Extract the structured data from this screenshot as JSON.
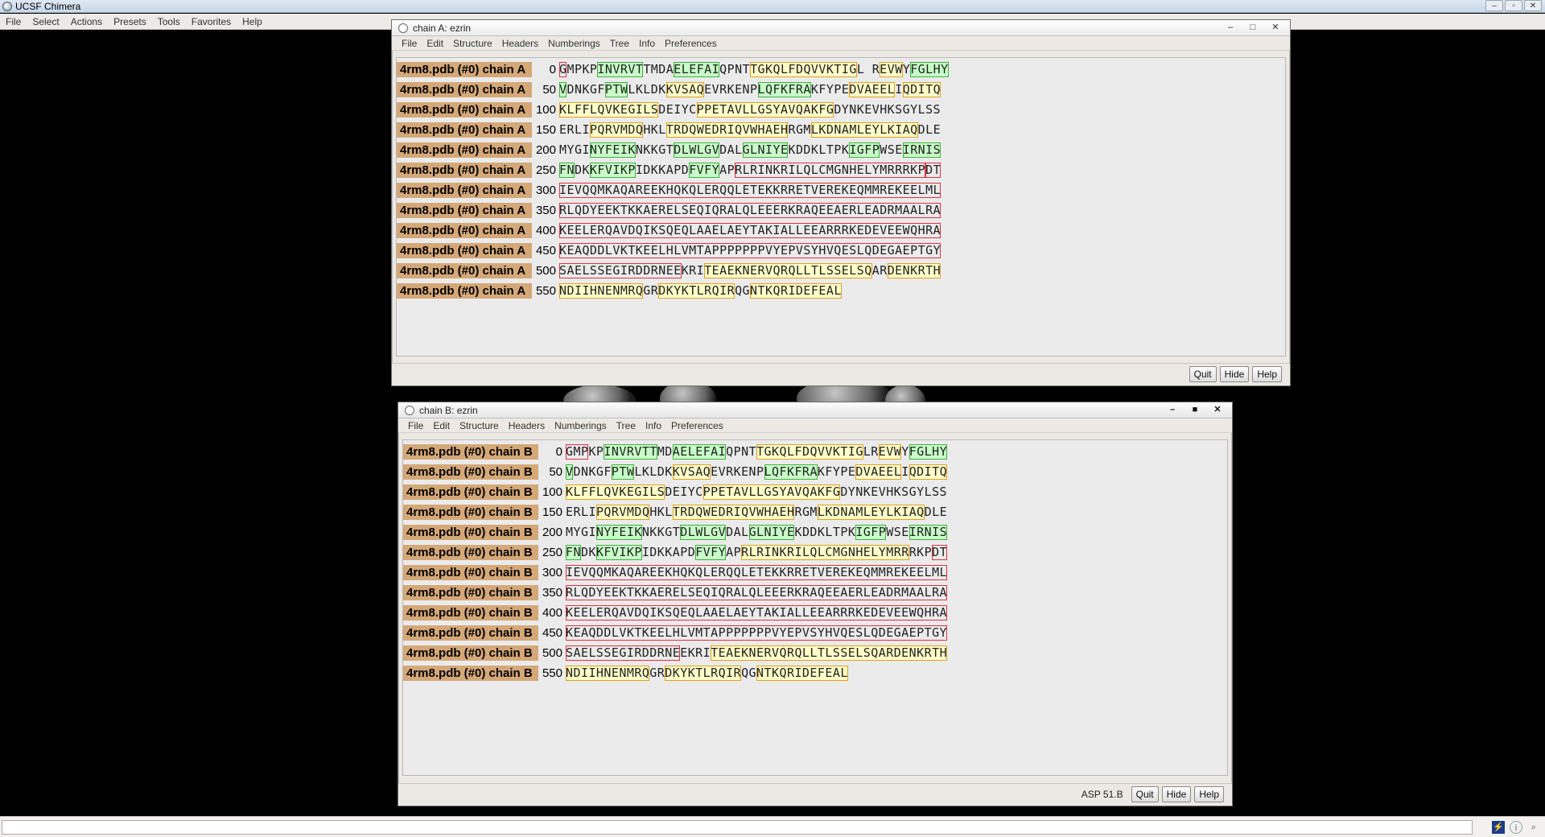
{
  "app": {
    "title": "UCSF Chimera",
    "menu": [
      "File",
      "Select",
      "Actions",
      "Presets",
      "Tools",
      "Favorites",
      "Help"
    ],
    "window_controls": [
      "–",
      "▫",
      "✕"
    ]
  },
  "windows": [
    {
      "title": "chain A: ezrin",
      "menu": [
        "File",
        "Edit",
        "Structure",
        "Headers",
        "Numberings",
        "Tree",
        "Info",
        "Preferences"
      ],
      "controls": [
        "–",
        "□",
        "✕"
      ],
      "status_text": "",
      "buttons": [
        "Quit",
        "Hide",
        "Help"
      ],
      "rows": [
        {
          "name": "4rm8.pdb (#0) chain A",
          "num": "0",
          "segs": [
            [
              "n",
              "0"
            ],
            [
              "r",
              "G"
            ],
            [
              "n",
              "MPKP"
            ],
            [
              "s",
              "INVRVT"
            ],
            [
              "n",
              "TMDA"
            ],
            [
              "s",
              "ELEFAI"
            ],
            [
              "n",
              "QPNT"
            ],
            [
              "h",
              "TGKQLFDQVVKTIG"
            ],
            [
              "n",
              "L R"
            ],
            [
              "h",
              "EVW"
            ],
            [
              "n",
              "Y"
            ],
            [
              "s",
              "FGLHY"
            ]
          ]
        },
        {
          "name": "4rm8.pdb (#0) chain A",
          "num": "50",
          "segs": [
            [
              "s",
              "V"
            ],
            [
              "n",
              "DNKGF"
            ],
            [
              "s",
              "PTW"
            ],
            [
              "n",
              "LKLDK"
            ],
            [
              "h",
              "KVSAQ"
            ],
            [
              "n",
              "EVRKENP"
            ],
            [
              "s",
              "LQFKFRA"
            ],
            [
              "n",
              "KFYPE"
            ],
            [
              "h",
              "DVAEEL"
            ],
            [
              "n",
              "I"
            ],
            [
              "h",
              "QDITQ"
            ]
          ]
        },
        {
          "name": "4rm8.pdb (#0) chain A",
          "num": "100",
          "segs": [
            [
              "h",
              "KLFFLQVKEGILS"
            ],
            [
              "n",
              "DEIYC"
            ],
            [
              "h",
              "PPETAVLLGSYAVQAKFG"
            ],
            [
              "n",
              "DYNKEVHKSGYLSS"
            ]
          ]
        },
        {
          "name": "4rm8.pdb (#0) chain A",
          "num": "150",
          "segs": [
            [
              "n",
              "ERLI"
            ],
            [
              "h",
              "PQRVMDQ"
            ],
            [
              "n",
              "HKL"
            ],
            [
              "h",
              "TRDQWEDRIQVWHAEH"
            ],
            [
              "n",
              "RGM"
            ],
            [
              "h",
              "LKDNAMLEYLKIAQ"
            ],
            [
              "n",
              "DLE"
            ]
          ]
        },
        {
          "name": "4rm8.pdb (#0) chain A",
          "num": "200",
          "segs": [
            [
              "n",
              "MYGI"
            ],
            [
              "s",
              "NYFEIK"
            ],
            [
              "n",
              "NKKGT"
            ],
            [
              "s",
              "DLWLGV"
            ],
            [
              "n",
              "DAL"
            ],
            [
              "s",
              "GLNIYE"
            ],
            [
              "n",
              "KDDKLTPK"
            ],
            [
              "s",
              "IGFP"
            ],
            [
              "n",
              "WSE"
            ],
            [
              "s",
              "IRNIS"
            ]
          ]
        },
        {
          "name": "4rm8.pdb (#0) chain A",
          "num": "250",
          "segs": [
            [
              "s",
              "FN"
            ],
            [
              "n",
              "DK"
            ],
            [
              "s",
              "KFVIKP"
            ],
            [
              "n",
              "IDKKAPD"
            ],
            [
              "s",
              "FVFY"
            ],
            [
              "n",
              "AP"
            ],
            [
              "r",
              "RLRINKRILQLCMGNHELYMRRRKP"
            ],
            [
              "r",
              "DT"
            ]
          ]
        },
        {
          "name": "4rm8.pdb (#0) chain A",
          "num": "300",
          "segs": [
            [
              "r",
              "IEVQQMKAQAREEKHQKQLERQQLETEKKRRETVEREKEQMMREKEELML"
            ]
          ]
        },
        {
          "name": "4rm8.pdb (#0) chain A",
          "num": "350",
          "segs": [
            [
              "r",
              "RLQDYEEKTKKAERELSEQIQRALQLEEERKRAQEEAERLEADRMAALRA"
            ]
          ]
        },
        {
          "name": "4rm8.pdb (#0) chain A",
          "num": "400",
          "segs": [
            [
              "r",
              "KEELERQAVDQIKSQEQLAAELAEYTAKIALLEEARRRKEDEVEEWQHRA"
            ]
          ]
        },
        {
          "name": "4rm8.pdb (#0) chain A",
          "num": "450",
          "segs": [
            [
              "r",
              "KEAQDDLVKTKEELHLVMTAPPPPPPPVYEPVSYHVQESLQDEGAEPTGY"
            ]
          ]
        },
        {
          "name": "4rm8.pdb (#0) chain A",
          "num": "500",
          "segs": [
            [
              "r",
              "SAELSSEGIRDDRNEE"
            ],
            [
              "n",
              "KRI"
            ],
            [
              "h",
              "TEAEKNERVQRQLLTLSSELSQ"
            ],
            [
              "n",
              "AR"
            ],
            [
              "h",
              "DENKRTH"
            ]
          ]
        },
        {
          "name": "4rm8.pdb (#0) chain A",
          "num": "550",
          "segs": [
            [
              "h",
              "NDIIHNENMRQ"
            ],
            [
              "n",
              "GR"
            ],
            [
              "h",
              "DKYKTLRQIR"
            ],
            [
              "n",
              "QG"
            ],
            [
              "h",
              "NTKQRIDEFEAL"
            ]
          ]
        }
      ]
    },
    {
      "title": "chain B: ezrin",
      "menu": [
        "File",
        "Edit",
        "Structure",
        "Headers",
        "Numberings",
        "Tree",
        "Info",
        "Preferences"
      ],
      "controls": [
        "–",
        "■",
        "✕"
      ],
      "status_text": "ASP 51.B",
      "buttons": [
        "Quit",
        "Hide",
        "Help"
      ],
      "rows": [
        {
          "name": "4rm8.pdb (#0) chain B",
          "num": "0",
          "segs": [
            [
              "r",
              "GMP"
            ],
            [
              "n",
              "KP"
            ],
            [
              "s",
              "INVRVTT"
            ],
            [
              "n",
              "MD"
            ],
            [
              "s",
              "AELEFAI"
            ],
            [
              "n",
              "QPNT"
            ],
            [
              "h",
              "TGKQLFDQVVKTIG"
            ],
            [
              "n",
              "LR"
            ],
            [
              "h",
              "EVW"
            ],
            [
              "n",
              "Y"
            ],
            [
              "s",
              "FGLHY"
            ]
          ]
        },
        {
          "name": "4rm8.pdb (#0) chain B",
          "num": "50",
          "segs": [
            [
              "s",
              "V"
            ],
            [
              "n",
              "DNKGF"
            ],
            [
              "s",
              "PTW"
            ],
            [
              "n",
              "LKLDK"
            ],
            [
              "h",
              "KVSAQ"
            ],
            [
              "n",
              "EVRKENP"
            ],
            [
              "s",
              "LQFKFRA"
            ],
            [
              "n",
              "KFYPE"
            ],
            [
              "h",
              "DVAEEL"
            ],
            [
              "n",
              "I"
            ],
            [
              "h",
              "QDITQ"
            ]
          ]
        },
        {
          "name": "4rm8.pdb (#0) chain B",
          "num": "100",
          "segs": [
            [
              "h",
              "KLFFLQVKEGILS"
            ],
            [
              "n",
              "DEIYC"
            ],
            [
              "h",
              "PPETAVLLGSYAVQAKFG"
            ],
            [
              "n",
              "DYNKEVHKSGYLSS"
            ]
          ]
        },
        {
          "name": "4rm8.pdb (#0) chain B",
          "num": "150",
          "segs": [
            [
              "n",
              "ERLI"
            ],
            [
              "h",
              "PQRVMDQ"
            ],
            [
              "n",
              "HKL"
            ],
            [
              "h",
              "TRDQWEDRIQVWHAEH"
            ],
            [
              "n",
              "RGM"
            ],
            [
              "h",
              "LKDNAMLEYLKIAQ"
            ],
            [
              "n",
              "DLE"
            ]
          ]
        },
        {
          "name": "4rm8.pdb (#0) chain B",
          "num": "200",
          "segs": [
            [
              "n",
              "MYGI"
            ],
            [
              "s",
              "NYFEIK"
            ],
            [
              "n",
              "NKKGT"
            ],
            [
              "s",
              "DLWLGV"
            ],
            [
              "n",
              "DAL"
            ],
            [
              "s",
              "GLNIYE"
            ],
            [
              "n",
              "KDDKLTPK"
            ],
            [
              "s",
              "IGFP"
            ],
            [
              "n",
              "WSE"
            ],
            [
              "s",
              "IRNIS"
            ]
          ]
        },
        {
          "name": "4rm8.pdb (#0) chain B",
          "num": "250",
          "segs": [
            [
              "s",
              "FN"
            ],
            [
              "n",
              "DK"
            ],
            [
              "s",
              "KFVIKP"
            ],
            [
              "n",
              "IDKKAPD"
            ],
            [
              "s",
              "FVFY"
            ],
            [
              "n",
              "AP"
            ],
            [
              "h",
              "RLRINKRILQLCMGNHELYMRR"
            ],
            [
              "n",
              "RKP"
            ],
            [
              "r",
              "DT"
            ]
          ]
        },
        {
          "name": "4rm8.pdb (#0) chain B",
          "num": "300",
          "segs": [
            [
              "r",
              "IEVQQMKAQAREEKHQKQLERQQLETEKKRRETVEREKEQMMREKEELML"
            ]
          ]
        },
        {
          "name": "4rm8.pdb (#0) chain B",
          "num": "350",
          "segs": [
            [
              "r",
              "RLQDYEEKTKKAERELSEQIQRALQLEEERKRAQEEAERLEADRMAALRA"
            ]
          ]
        },
        {
          "name": "4rm8.pdb (#0) chain B",
          "num": "400",
          "segs": [
            [
              "r",
              "KEELERQAVDQIKSQEQLAAELAEYTAKIALLEEARRRKEDEVEEWQHRA"
            ]
          ]
        },
        {
          "name": "4rm8.pdb (#0) chain B",
          "num": "450",
          "segs": [
            [
              "r",
              "KEAQDDLVKTKEELHLVMTAPPPPPPPVYEPVSYHVQESLQDEGAEPTGY"
            ]
          ]
        },
        {
          "name": "4rm8.pdb (#0) chain B",
          "num": "500",
          "segs": [
            [
              "r",
              "SAELSSEGIRDDRNE"
            ],
            [
              "n",
              "EKRI"
            ],
            [
              "h",
              "TEAEKNERVQRQLLTLSSELSQARDENKRTH"
            ]
          ]
        },
        {
          "name": "4rm8.pdb (#0) chain B",
          "num": "550",
          "segs": [
            [
              "h",
              "NDIIHNENMRQ"
            ],
            [
              "n",
              "GR"
            ],
            [
              "h",
              "DKYKTLRQIR"
            ],
            [
              "n",
              "QG"
            ],
            [
              "h",
              "NTKQRIDEFEAL"
            ]
          ]
        }
      ]
    }
  ],
  "statusbar": {
    "icons": [
      "lightning-icon",
      "info-icon",
      "zoom-icon"
    ]
  },
  "colors": {
    "name_bg": "#d5a878",
    "helix_bg": "#ffffc8",
    "helix_border": "#e0a020",
    "strand_bg": "#c8ffc8",
    "strand_border": "#40b040",
    "region_border": "#e03040"
  }
}
